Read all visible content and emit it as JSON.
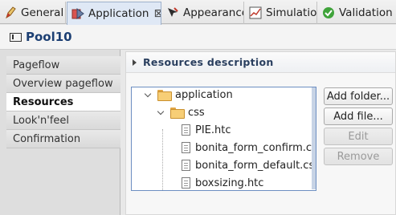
{
  "tabs": [
    {
      "label": "General",
      "icon": "pencil-icon",
      "active": false
    },
    {
      "label": "Application",
      "icon": "application-icon",
      "active": true
    },
    {
      "label": "Appearance",
      "icon": "appearance-icon",
      "active": false
    },
    {
      "label": "Simulation",
      "icon": "chart-icon",
      "active": false
    },
    {
      "label": "Validation st",
      "icon": "check-circle-icon",
      "active": false
    }
  ],
  "header": {
    "title": "Pool10"
  },
  "sidebar": {
    "items": [
      {
        "label": "Pageflow",
        "selected": false
      },
      {
        "label": "Overview pageflow",
        "selected": false
      },
      {
        "label": "Resources",
        "selected": true
      },
      {
        "label": "Look'n'feel",
        "selected": false
      },
      {
        "label": "Confirmation",
        "selected": false
      }
    ]
  },
  "section": {
    "title": "Resources description"
  },
  "tree": {
    "items": [
      {
        "label": "application",
        "type": "folder",
        "expanded": true
      },
      {
        "label": "css",
        "type": "folder",
        "expanded": true
      },
      {
        "label": "PIE.htc",
        "type": "file"
      },
      {
        "label": "bonita_form_confirm.css",
        "type": "file"
      },
      {
        "label": "bonita_form_default.css",
        "type": "file"
      },
      {
        "label": "boxsizing.htc",
        "type": "file"
      }
    ]
  },
  "buttons": {
    "add_folder": "Add folder...",
    "add_file": "Add file...",
    "edit": "Edit",
    "remove": "Remove"
  },
  "colors": {
    "title": "#1c3f73",
    "tree_border": "#6d8fc2",
    "active_tab": "#dfe8f5"
  }
}
